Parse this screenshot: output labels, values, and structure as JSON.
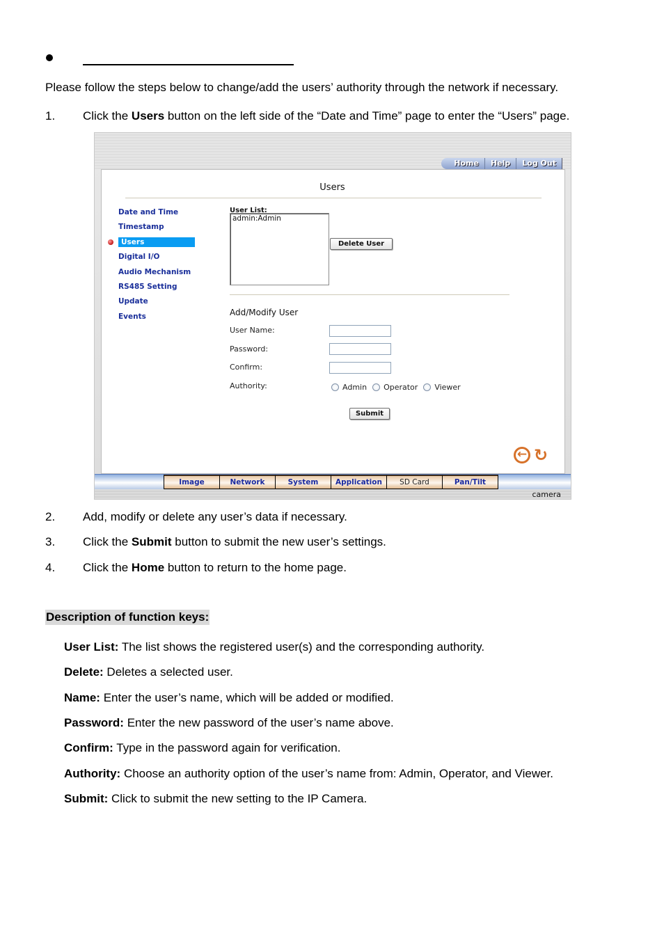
{
  "intro": "Please follow the steps below to change/add the users’ authority through the network if necessary.",
  "steps": [
    {
      "num": "1.",
      "pre": "Click the ",
      "bold": "Users",
      "post": " button on the left side of the “Date and Time” page to enter the “Users” page."
    },
    {
      "num": "2.",
      "pre": "Add, modify or delete any user’s data if necessary.",
      "bold": "",
      "post": ""
    },
    {
      "num": "3.",
      "pre": "Click the ",
      "bold": "Submit",
      "post": " button to submit the new user’s settings."
    },
    {
      "num": "4.",
      "pre": "Click the ",
      "bold": "Home",
      "post": " button to return to the home page."
    }
  ],
  "description": {
    "heading": "Description of function keys:",
    "items": [
      {
        "term": "User List:",
        "text": " The list shows the registered user(s) and the corresponding authority."
      },
      {
        "term": "Delete:",
        "text": " Deletes a selected user."
      },
      {
        "term": "Name:",
        "text": " Enter the user’s name, which will be added or modified."
      },
      {
        "term": "Password:",
        "text": " Enter the new password of the user’s name above."
      },
      {
        "term": "Confirm:",
        "text": " Type in the password again for verification."
      },
      {
        "term": "Authority:",
        "text": " Choose an authority option of the user’s name from: Admin, Operator, and Viewer."
      },
      {
        "term": "Submit:",
        "text": " Click to submit the new setting to the IP Camera."
      }
    ]
  },
  "screenshot": {
    "top_nav": [
      "Home",
      "Help",
      "Log Out"
    ],
    "title": "Users",
    "sidebar": [
      {
        "label": "Date and Time",
        "active": false
      },
      {
        "label": "Timestamp",
        "active": false
      },
      {
        "label": "Users",
        "active": true
      },
      {
        "label": "Digital I/O",
        "active": false
      },
      {
        "label": "Audio Mechanism",
        "active": false
      },
      {
        "label": "RS485 Setting",
        "active": false
      },
      {
        "label": "Update",
        "active": false
      },
      {
        "label": "Events",
        "active": false
      }
    ],
    "user_list_label": "User List:",
    "user_list": [
      "admin:Admin"
    ],
    "delete_button": "Delete User",
    "add_modify_heading": "Add/Modify User",
    "fields": {
      "user_name": {
        "label": "User Name:",
        "value": ""
      },
      "password": {
        "label": "Password:",
        "value": ""
      },
      "confirm": {
        "label": "Confirm:",
        "value": ""
      }
    },
    "authority_label": "Authority:",
    "authority_options": [
      "Admin",
      "Operator",
      "Viewer"
    ],
    "submit_button": "Submit",
    "bottom_tabs": [
      "Image",
      "Network",
      "System",
      "Application",
      "SD Card",
      "Pan/Tilt"
    ],
    "status_text": "camera",
    "accent_colors": {
      "link": "#1a2f9a",
      "active_item": "#0a9cf2",
      "icon": "#d7722a"
    }
  }
}
